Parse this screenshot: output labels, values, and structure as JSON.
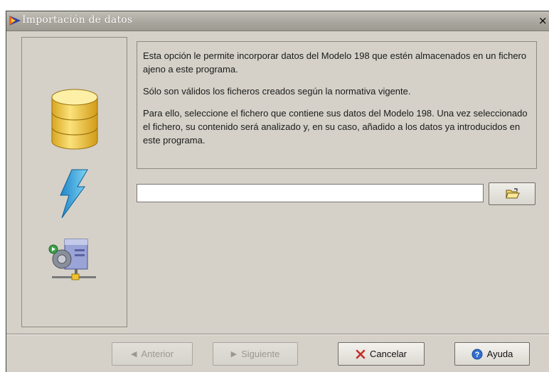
{
  "window": {
    "title": "Importación de datos",
    "close_glyph": "×"
  },
  "icons": [
    "app-icon",
    "database-icon",
    "lightning-icon",
    "network-server-icon",
    "open-folder-icon",
    "left-arrow-icon",
    "right-arrow-icon",
    "cancel-x-icon",
    "help-icon"
  ],
  "description": {
    "paragraphs": [
      "Esta opción le permite incorporar datos del Modelo 198 que estén almacenados en un fichero ajeno a este programa.",
      "Sólo son válidos los ficheros creados según la normativa vigente.",
      "Para ello, seleccione el fichero que contiene sus datos del Modelo 198. Una vez seleccionado el fichero, su contenido será analizado y, en su caso, añadido a los datos ya introducidos en este programa."
    ]
  },
  "file_field": {
    "value": "",
    "placeholder": ""
  },
  "buttons": {
    "back": "Anterior",
    "next": "Siguiente",
    "cancel": "Cancelar",
    "help": "Ayuda"
  },
  "colors": {
    "background": "#d5d1c8",
    "titlebar": "#aaa79f",
    "help_blue": "#2f6fd0",
    "cancel_red": "#c4302b"
  }
}
